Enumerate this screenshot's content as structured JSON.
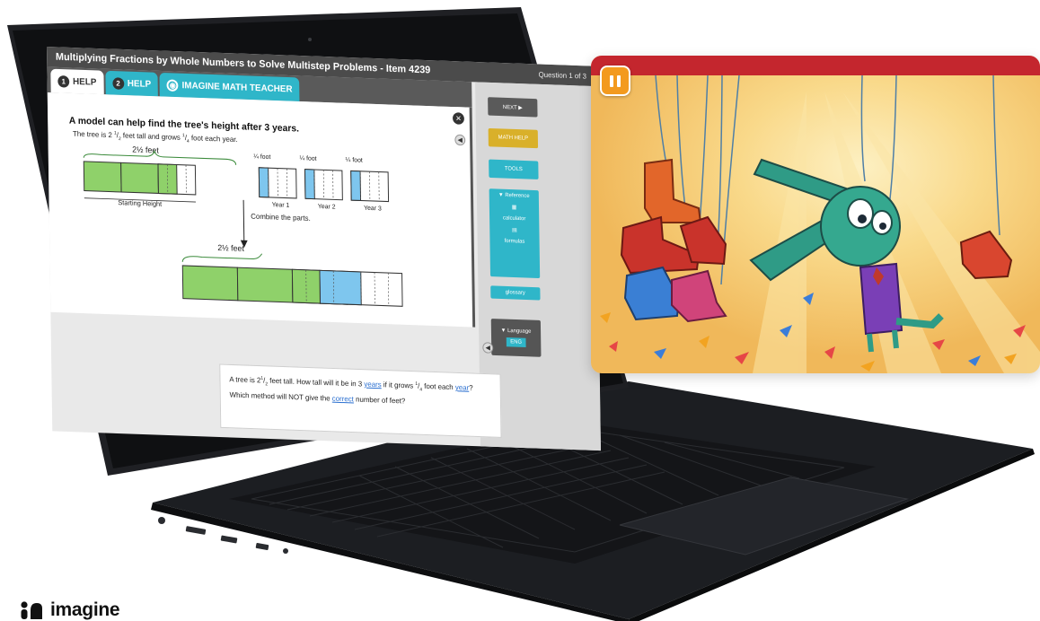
{
  "window": {
    "title": "Multiplying Fractions by Whole Numbers to Solve Multistep Problems - Item 4239",
    "question_counter": "Question 1 of 3"
  },
  "tabs": [
    {
      "number": "1",
      "label": "HELP",
      "active": true
    },
    {
      "number": "2",
      "label": "HELP",
      "active": false
    },
    {
      "label": "IMAGINE MATH TEACHER",
      "active": false
    }
  ],
  "help": {
    "heading": "A model can help find the tree's height after 3 years.",
    "intro_prefix": "The tree is 2",
    "intro_mid": "feet tall and grows",
    "intro_suffix": "foot each year.",
    "fraction_half": {
      "num": "1",
      "den": "2"
    },
    "fraction_quarter": {
      "num": "1",
      "den": "4"
    },
    "whole_2": "2",
    "feet": "feet",
    "foot": "foot",
    "starting_height": "Starting Height",
    "year_1": "Year 1",
    "year_2": "Year 2",
    "year_3": "Year 3",
    "combine": "Combine the parts."
  },
  "sidebar": {
    "next": "NEXT ▶",
    "math_help": "MATH HELP",
    "tools": "TOOLS",
    "reference": "▼ Reference",
    "calculator": "calculator",
    "formulas": "formulas",
    "glossary": "glossary",
    "language": "▼ Language",
    "english": "ENG"
  },
  "question": {
    "line1_a": "A tree is 2",
    "line1_b": "feet tall. How tall will it be in 3",
    "line1_years": "years",
    "line1_c": "if it grows",
    "line1_d": "foot each",
    "line1_year": "year",
    "line1_end": "?",
    "line2_a": "Which method will NOT give the",
    "line2_correct": "correct",
    "line2_b": "number of feet?"
  },
  "brand": {
    "name": "imagine"
  },
  "colors": {
    "green": "#8fd16a",
    "blue": "#7ec6ee",
    "teal_tab": "#2fb6c9",
    "gold": "#d9b02a",
    "game_bg": "#f6c86a",
    "game_topbar": "#c4262e",
    "pause": "#f39a1e"
  },
  "icons": [
    "pause-icon",
    "close-icon",
    "speaker-icon",
    "calculator-icon",
    "formulas-icon",
    "glossary-icon",
    "imagine-logo-icon"
  ]
}
